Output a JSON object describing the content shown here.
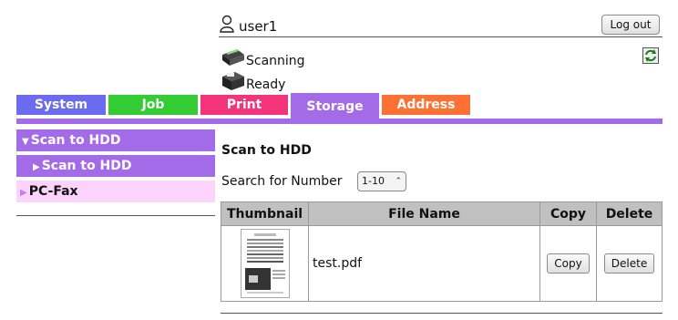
{
  "header": {
    "user_name": "user1",
    "logout_label": "Log out",
    "status": [
      {
        "icon": "scanner-icon",
        "text": "Scanning"
      },
      {
        "icon": "printer-icon",
        "text": "Ready"
      }
    ],
    "refresh_icon": "refresh-icon"
  },
  "tabs": [
    {
      "label": "System",
      "color": "#6b6bf0"
    },
    {
      "label": "Job",
      "color": "#33cc33"
    },
    {
      "label": "Print",
      "color": "#f2357a"
    },
    {
      "label": "Storage",
      "color": "#a46be8",
      "active": true
    },
    {
      "label": "Address",
      "color": "#ff7033"
    }
  ],
  "sidebar": {
    "items": [
      {
        "label": "Scan to HDD",
        "expanded": true
      },
      {
        "label": "Scan to HDD",
        "selected": true
      },
      {
        "label": "PC-Fax"
      }
    ]
  },
  "main": {
    "title": "Scan to HDD",
    "search_label": "Search for Number",
    "search_value": "1-10",
    "table": {
      "headers": [
        "Thumbnail",
        "File Name",
        "Copy",
        "Delete"
      ],
      "rows": [
        {
          "file_name": "test.pdf",
          "copy_label": "Copy",
          "delete_label": "Delete"
        }
      ]
    }
  },
  "colors": {
    "accent": "#a46be8",
    "fax_bg": "#fcd3fc",
    "header_bg": "#c0c0c0"
  }
}
